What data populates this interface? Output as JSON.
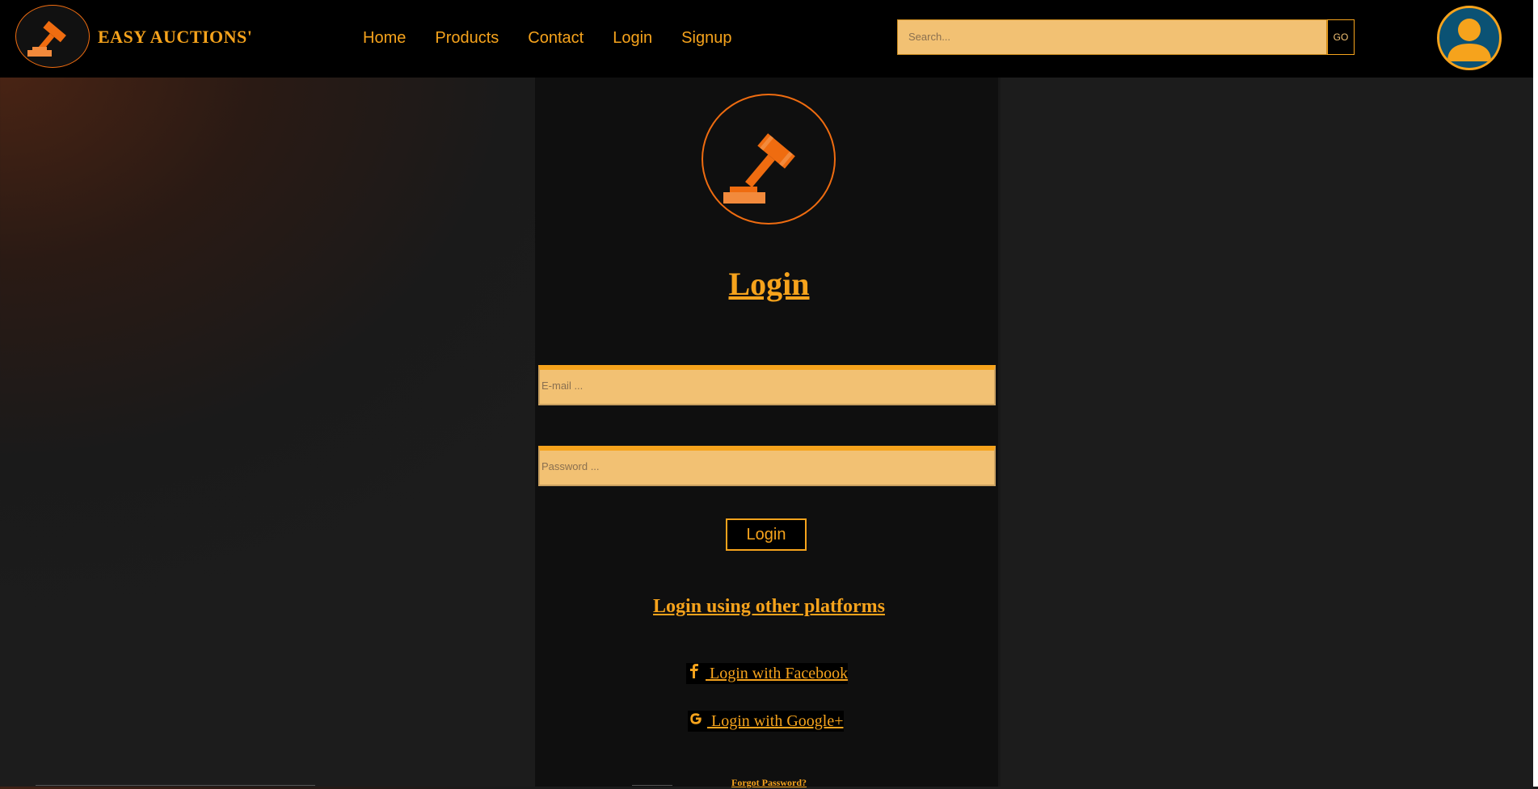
{
  "brand": {
    "name": "EASY AUCTIONS'",
    "logo_icon": "gavel-icon"
  },
  "nav": {
    "items": [
      {
        "label": "Home"
      },
      {
        "label": "Products"
      },
      {
        "label": "Contact"
      },
      {
        "label": "Login"
      },
      {
        "label": "Signup"
      }
    ]
  },
  "search": {
    "placeholder": "Search...",
    "button_label": "GO"
  },
  "account": {
    "icon": "user-avatar-icon"
  },
  "login": {
    "logo_icon": "gavel-icon",
    "title": "Login",
    "email_placeholder": "E-mail ...",
    "password_placeholder": "Password ...",
    "submit_label": "Login",
    "other_platforms_title": "Login using other platforms",
    "facebook_label": " Login with Facebook",
    "google_label": " Login with Google+",
    "forgot_label": "Forgot Password?"
  },
  "colors": {
    "accent": "#f6a31c",
    "field_bg": "#f2c173",
    "logo_orange": "#ef6c10",
    "header_bg": "#000000",
    "avatar_bg": "#0b5274"
  }
}
